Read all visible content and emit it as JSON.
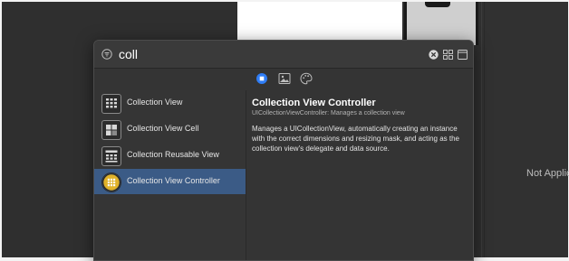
{
  "search": {
    "query": "coll"
  },
  "tabs": [
    {
      "name": "objects",
      "icon": "circle-objects-icon",
      "active": true,
      "accent": "#2f7df6"
    },
    {
      "name": "media",
      "icon": "image-icon",
      "active": false
    },
    {
      "name": "colors",
      "icon": "palette-icon",
      "active": false
    }
  ],
  "library_items": [
    {
      "label": "Collection View",
      "icon": "collection-view-icon",
      "selected": false
    },
    {
      "label": "Collection View Cell",
      "icon": "collection-view-cell-icon",
      "selected": false
    },
    {
      "label": "Collection Reusable View",
      "icon": "collection-reusable-view-icon",
      "selected": false
    },
    {
      "label": "Collection View Controller",
      "icon": "collection-view-controller-icon",
      "selected": true
    }
  ],
  "detail": {
    "title": "Collection View Controller",
    "subtitle": "UICollectionViewController: Manages a collection view",
    "body": "Manages a UICollectionView, automatically creating an instance with the correct dimensions and resizing mask, and acting as the collection view's delegate and data source."
  },
  "right_panel": {
    "status_text": "Not Applic"
  },
  "colors": {
    "selection": "#3b5b86",
    "controller_icon": "#e0b22a",
    "background": "#2f2f2f",
    "popover": "#343434"
  }
}
